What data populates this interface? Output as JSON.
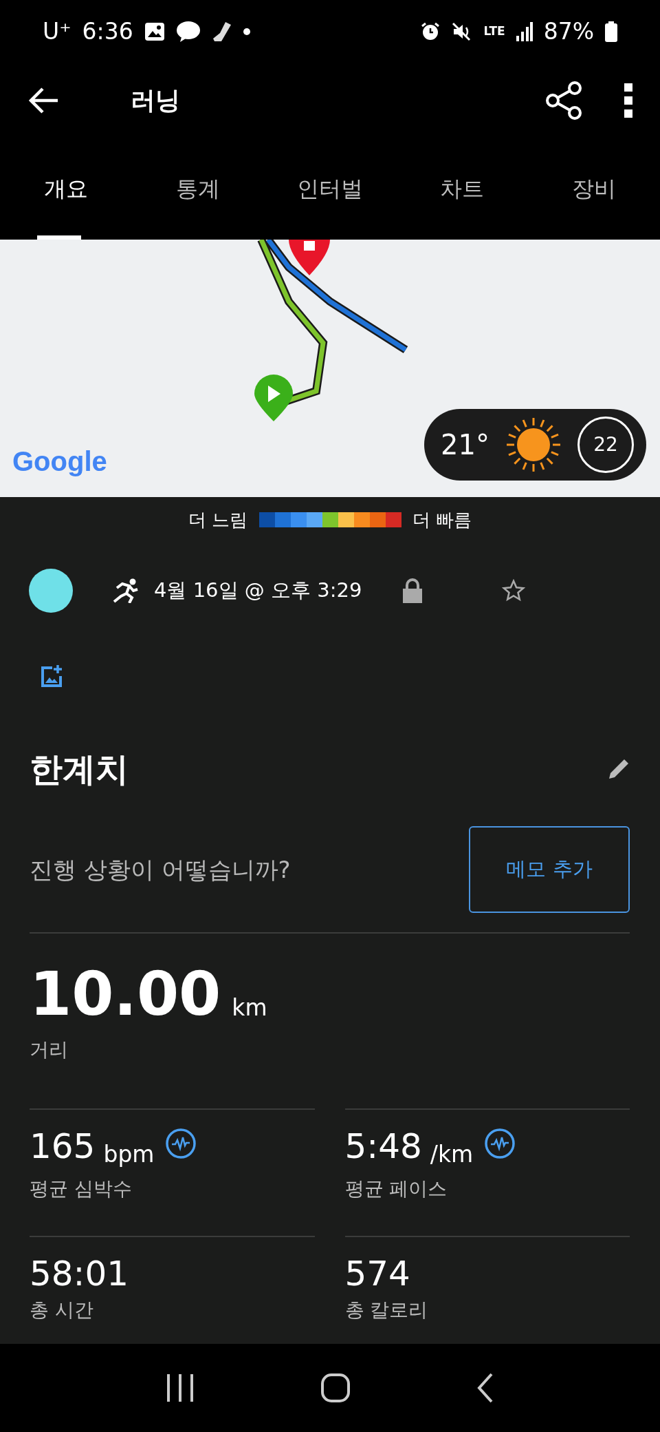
{
  "status_bar": {
    "carrier": "U⁺",
    "time": "6:36",
    "network": "LTE",
    "battery": "87%"
  },
  "app_bar": {
    "title": "러닝"
  },
  "tabs": [
    {
      "label": "개요",
      "selected": true
    },
    {
      "label": "통계",
      "selected": false
    },
    {
      "label": "인터벌",
      "selected": false
    },
    {
      "label": "차트",
      "selected": false
    },
    {
      "label": "장비",
      "selected": false
    }
  ],
  "map": {
    "logo": "Google",
    "weather": {
      "temperature": "21°",
      "wind": "22"
    }
  },
  "pace_legend": {
    "slow_label": "더 느림",
    "fast_label": "더 빠름",
    "segments": [
      {
        "color": "#0d4ea6"
      },
      {
        "color": "#1f72d6"
      },
      {
        "color": "#3a8ff0"
      },
      {
        "color": "#5aa8f5"
      },
      {
        "color": "#7ec42c"
      },
      {
        "color": "#f9c04a"
      },
      {
        "color": "#f78b1f"
      },
      {
        "color": "#ea6512"
      },
      {
        "color": "#d62a24"
      }
    ]
  },
  "activity": {
    "date": "4월 16일 @ 오후 3:29",
    "private": true,
    "favorite": false
  },
  "title": "한계치",
  "notes": {
    "prompt": "진행 상황이 어떻습니까?",
    "button": "메모 추가"
  },
  "distance": {
    "value": "10.00",
    "unit": "km",
    "label": "거리"
  },
  "stats": [
    {
      "value": "165",
      "unit": "bpm",
      "label": "평균 심박수",
      "detail_icon": true
    },
    {
      "value": "5:48",
      "unit": "/km",
      "label": "평균 페이스",
      "detail_icon": true
    },
    {
      "value": "58:01",
      "label": "총 시간",
      "detail_icon": false
    },
    {
      "value": "574",
      "label": "총 칼로리",
      "detail_icon": false
    }
  ]
}
